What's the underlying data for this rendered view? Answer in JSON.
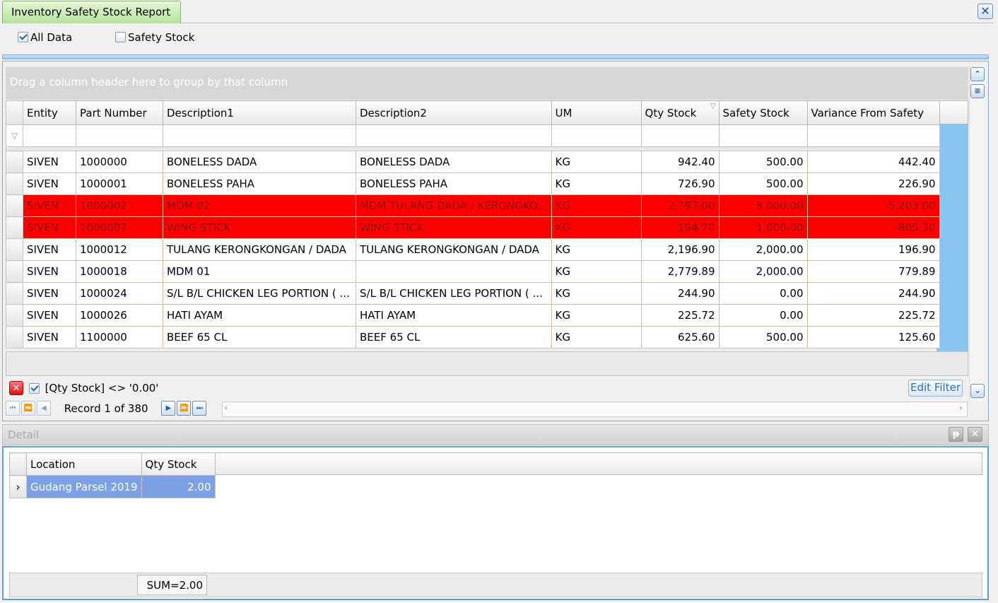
{
  "window": {
    "tab_title": "Inventory Safety Stock Report",
    "close_icon": "close-icon"
  },
  "options": {
    "all_data": {
      "label": "All Data",
      "checked": true
    },
    "safety_stock": {
      "label": "Safety Stock",
      "checked": false
    }
  },
  "grid": {
    "group_hint": "Drag a column header here to group by that column",
    "columns": [
      "Entity",
      "Part Number",
      "Description1",
      "Description2",
      "UM",
      "Qty Stock",
      "Safety Stock",
      "Variance From Safety"
    ],
    "highlight_color": "#ff0000",
    "rows": [
      {
        "entity": "SIVEN",
        "part": "1000000",
        "desc1": "BONELESS DADA",
        "desc2": "BONELESS DADA",
        "um": "KG",
        "qty": "942.40",
        "safety": "500.00",
        "variance": "442.40",
        "below": false
      },
      {
        "entity": "SIVEN",
        "part": "1000001",
        "desc1": "BONELESS PAHA",
        "desc2": "BONELESS PAHA",
        "um": "KG",
        "qty": "726.90",
        "safety": "500.00",
        "variance": "226.90",
        "below": false
      },
      {
        "entity": "SIVEN",
        "part": "1000002",
        "desc1": "MDM 02",
        "desc2": "MDM TULANG DADA / KERONGKO...",
        "um": "KG",
        "qty": "2,797.00",
        "safety": "8,000.00",
        "variance": "-5,203.00",
        "below": true
      },
      {
        "entity": "SIVEN",
        "part": "1000007",
        "desc1": "WING STICK",
        "desc2": "WING STICK",
        "um": "KG",
        "qty": "194.70",
        "safety": "1,000.00",
        "variance": "-805.30",
        "below": true
      },
      {
        "entity": "SIVEN",
        "part": "1000012",
        "desc1": "TULANG KERONGKONGAN / DADA",
        "desc2": "TULANG KERONGKONGAN / DADA",
        "um": "KG",
        "qty": "2,196.90",
        "safety": "2,000.00",
        "variance": "196.90",
        "below": false
      },
      {
        "entity": "SIVEN",
        "part": "1000018",
        "desc1": "MDM 01",
        "desc2": "",
        "um": "KG",
        "qty": "2,779.89",
        "safety": "2,000.00",
        "variance": "779.89",
        "below": false
      },
      {
        "entity": "SIVEN",
        "part": "1000024",
        "desc1": "S/L B/L CHICKEN LEG PORTION ( ...",
        "desc2": "S/L B/L CHICKEN LEG PORTION ( ...",
        "um": "KG",
        "qty": "244.90",
        "safety": "0.00",
        "variance": "244.90",
        "below": false
      },
      {
        "entity": "SIVEN",
        "part": "1000026",
        "desc1": "HATI AYAM",
        "desc2": "HATI AYAM",
        "um": "KG",
        "qty": "225.72",
        "safety": "0.00",
        "variance": "225.72",
        "below": false
      },
      {
        "entity": "SIVEN",
        "part": "1100000",
        "desc1": "BEEF 65 CL",
        "desc2": "BEEF 65 CL",
        "um": "KG",
        "qty": "625.60",
        "safety": "500.00",
        "variance": "125.60",
        "below": false
      }
    ],
    "filter_expression": "[Qty Stock] <> '0.00'",
    "edit_filter_label": "Edit Filter",
    "record_text": "Record 1 of 380"
  },
  "detail": {
    "title": "Detail",
    "columns": [
      "Location",
      "Qty Stock"
    ],
    "rows": [
      {
        "location": "Gudang Parsel 2019",
        "qty": "2.00"
      }
    ],
    "sum_text": "SUM=2.00"
  }
}
